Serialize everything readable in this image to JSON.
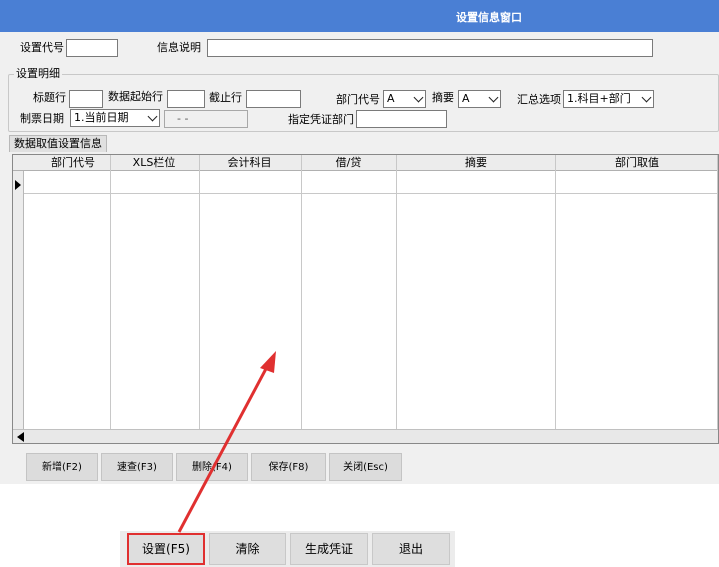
{
  "window": {
    "title": "设置信息窗口"
  },
  "header": {
    "code_label": "设置代号",
    "code_value": "",
    "desc_label": "信息说明",
    "desc_value": ""
  },
  "detail": {
    "group_title": "设置明细",
    "title_row_label": "标题行",
    "title_row_value": "",
    "data_start_label": "数据起始行",
    "data_start_value": "",
    "end_row_label": "截止行",
    "end_row_value": "",
    "dept_code_label": "部门代号",
    "dept_code_value": "A",
    "summary_label": "摘要",
    "summary_value": "A",
    "aggregate_label": "汇总选项",
    "aggregate_value": "1.科目+部门",
    "voucher_date_label": "制票日期",
    "voucher_date_value": "1.当前日期",
    "date_value": "- -",
    "assign_dept_label": "指定凭证部门",
    "assign_dept_value": ""
  },
  "tab": {
    "label": "数据取值设置信息"
  },
  "grid": {
    "columns": [
      "部门代号",
      "XLS栏位",
      "会计科目",
      "借/贷",
      "摘要",
      "部门取值"
    ]
  },
  "toolbar": {
    "add": "新增(F2)",
    "quick": "速查(F3)",
    "delete": "删除(F4)",
    "save": "保存(F8)",
    "close": "关闭(Esc)"
  },
  "bottom_bar": {
    "settings": "设置(F5)",
    "clear": "清除",
    "generate": "生成凭证",
    "exit": "退出"
  },
  "colors": {
    "title_bar": "#4a7fd4",
    "annotation": "#e03030"
  }
}
